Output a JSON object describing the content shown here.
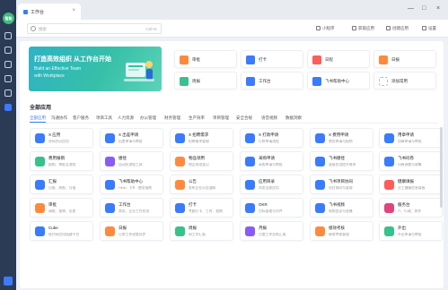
{
  "rail": {
    "logo_text": "智能"
  },
  "titlebar": {
    "tab_label": "工作台",
    "close": "×",
    "minimize": "—",
    "maximize": "□",
    "window_close": "×"
  },
  "toolbar": {
    "search_placeholder": "搜索",
    "search_shortcut": "Ctrl+K",
    "tools": [
      "小程序",
      "获取应用",
      "创建应用",
      "设置"
    ]
  },
  "banner": {
    "title": "打造高效组织 从工作台开始",
    "subtitle_en_1": "Build an Effective Team",
    "subtitle_en_2": "with Workplace"
  },
  "quick": [
    {
      "label": "审批",
      "color": "#ff8a3d"
    },
    {
      "label": "打卡",
      "color": "#3a7bff"
    },
    {
      "label": "日程",
      "color": "#ff5c5c"
    },
    {
      "label": "日报",
      "color": "#ff8a3d"
    },
    {
      "label": "周报",
      "color": "#37c18c"
    },
    {
      "label": "工作台",
      "color": "#3a7bff"
    },
    {
      "label": "飞书帮助中心",
      "color": "#3a7bff"
    },
    {
      "label": "添加常用",
      "color": "#ffffff"
    }
  ],
  "section_title": "全部应用",
  "categories": [
    "全部应用",
    "沟通协作",
    "客户服务",
    "项目工具",
    "人力资源",
    "办公管理",
    "财务管理",
    "生产效率",
    "项目管理",
    "安全合规",
    "语音视频",
    "数据洞察"
  ],
  "apps": [
    {
      "name": "X 应用",
      "desc": "协同办公应用",
      "color": "#3a7bff"
    },
    {
      "name": "X 出差申请",
      "desc": "出差申请与审批",
      "color": "#3a7bff"
    },
    {
      "name": "X 招聘需求",
      "desc": "招聘需求管理",
      "color": "#3a7bff"
    },
    {
      "name": "X 打款申请",
      "desc": "打款申请流程",
      "color": "#3a7bff"
    },
    {
      "name": "X 费用申请",
      "desc": "费用申请与报销",
      "color": "#3a7bff"
    },
    {
      "name": "用章申请",
      "desc": "用章申请与审批",
      "color": "#3a7bff"
    },
    {
      "name": "费用报销",
      "desc": "报销、审批全流程",
      "color": "#37c18c"
    },
    {
      "name": "捷径",
      "desc": "自动化流程工具",
      "color": "#8a5cf6"
    },
    {
      "name": "物品领用",
      "desc": "物品领用登记",
      "color": "#ff8a3d"
    },
    {
      "name": "采购申请",
      "desc": "采购申请与审批",
      "color": "#3a7bff"
    },
    {
      "name": "飞书捷径",
      "desc": "连接应用提升效率",
      "color": "#3a7bff"
    },
    {
      "name": "飞书问卷",
      "desc": "问卷调查与收集",
      "color": "#3a7bff"
    },
    {
      "name": "汇报",
      "desc": "日报、周报、月报",
      "color": "#3a7bff"
    },
    {
      "name": "飞书帮助中心",
      "desc": "Hello, 飞书 · 使用指南",
      "color": "#3a7bff"
    },
    {
      "name": "公告",
      "desc": "发布企业公告通知",
      "color": "#ff8a3d"
    },
    {
      "name": "应用目录",
      "desc": "浏览全部应用",
      "color": "#3a7bff"
    },
    {
      "name": "飞书项目协同",
      "desc": "项目协同与管理",
      "color": "#3a7bff"
    },
    {
      "name": "健康填报",
      "desc": "员工健康信息填报",
      "color": "#ff5c5c"
    },
    {
      "name": "审批",
      "desc": "请假、报销、出差",
      "color": "#ff8a3d"
    },
    {
      "name": "工作台",
      "desc": "常用、企业工作应用",
      "color": "#3a7bff"
    },
    {
      "name": "打卡",
      "desc": "考勤打卡、工时、假期",
      "color": "#3a7bff"
    },
    {
      "name": "OKR",
      "desc": "目标管理与对齐",
      "color": "#3a7bff"
    },
    {
      "name": "飞书视频",
      "desc": "视频会议与直播",
      "color": "#3a7bff"
    },
    {
      "name": "服务台",
      "desc": "IT、行政、协作",
      "color": "#e0457b"
    },
    {
      "name": "Cube",
      "desc": "低代码应用搭建平台",
      "color": "#3a7bff"
    },
    {
      "name": "日报",
      "desc": "日常工作进度同步",
      "color": "#ff8a3d"
    },
    {
      "name": "周报",
      "desc": "周工作汇报",
      "color": "#37c18c"
    },
    {
      "name": "月报",
      "desc": "月度工作总结汇报",
      "color": "#8a5cf6"
    },
    {
      "name": "绩效考核",
      "desc": "绩效考核管理",
      "color": "#ff8a3d"
    },
    {
      "name": "外出",
      "desc": "外出申请与审批",
      "color": "#37c18c"
    }
  ]
}
